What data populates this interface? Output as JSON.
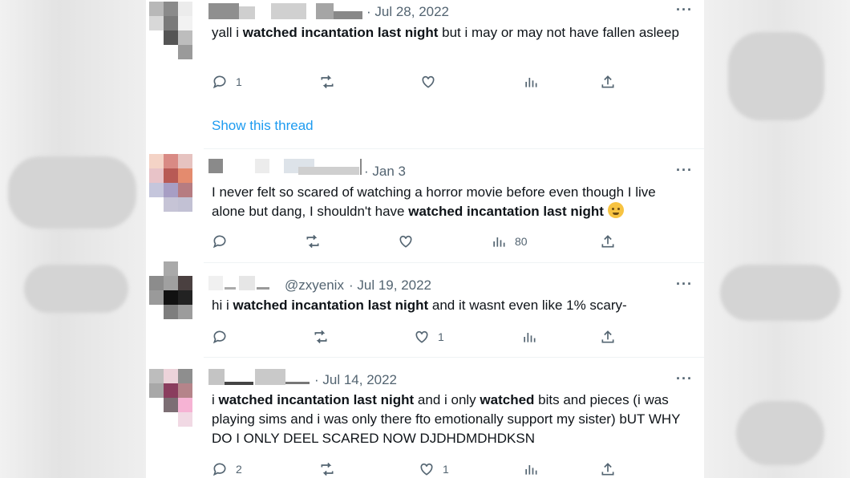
{
  "tweets": [
    {
      "handle": "",
      "date": "· Jul 28, 2022",
      "text_parts": [
        "yall i ",
        "watched incantation last night",
        " but i may or may not have fallen asleep"
      ],
      "replies": "1",
      "retweets": "",
      "likes": "",
      "views": "",
      "show_thread": "Show this thread"
    },
    {
      "handle": "",
      "date": "· Jan 3",
      "text_parts": [
        "I never felt so scared of watching a horror movie before even though I live alone but dang, I shouldn't have ",
        "watched incantation last night",
        " "
      ],
      "emoji": "crying-face-emoji",
      "replies": "",
      "retweets": "",
      "likes": "",
      "views": "80"
    },
    {
      "handle": "@zxyenix",
      "date": "· Jul 19, 2022",
      "text_parts": [
        "hi i ",
        "watched incantation last night",
        " and it wasnt even like 1% scary-"
      ],
      "replies": "",
      "retweets": "",
      "likes": "1",
      "views": ""
    },
    {
      "handle": "",
      "date": "· Jul 14, 2022",
      "text_parts": [
        "i ",
        "watched incantation last night",
        " and i only ",
        "watched",
        " bits and pieces (i was playing sims and i was only there fto emotionally support my sister) bUT WHY DO I ONLY DEEL SCARED NOW DJDHDMDHDKSN"
      ],
      "replies": "2",
      "retweets": "",
      "likes": "1",
      "views": ""
    }
  ],
  "more_icon": "···",
  "colors": {
    "link": "#1d9bf0",
    "muted": "#536471",
    "text": "#0f1419"
  }
}
